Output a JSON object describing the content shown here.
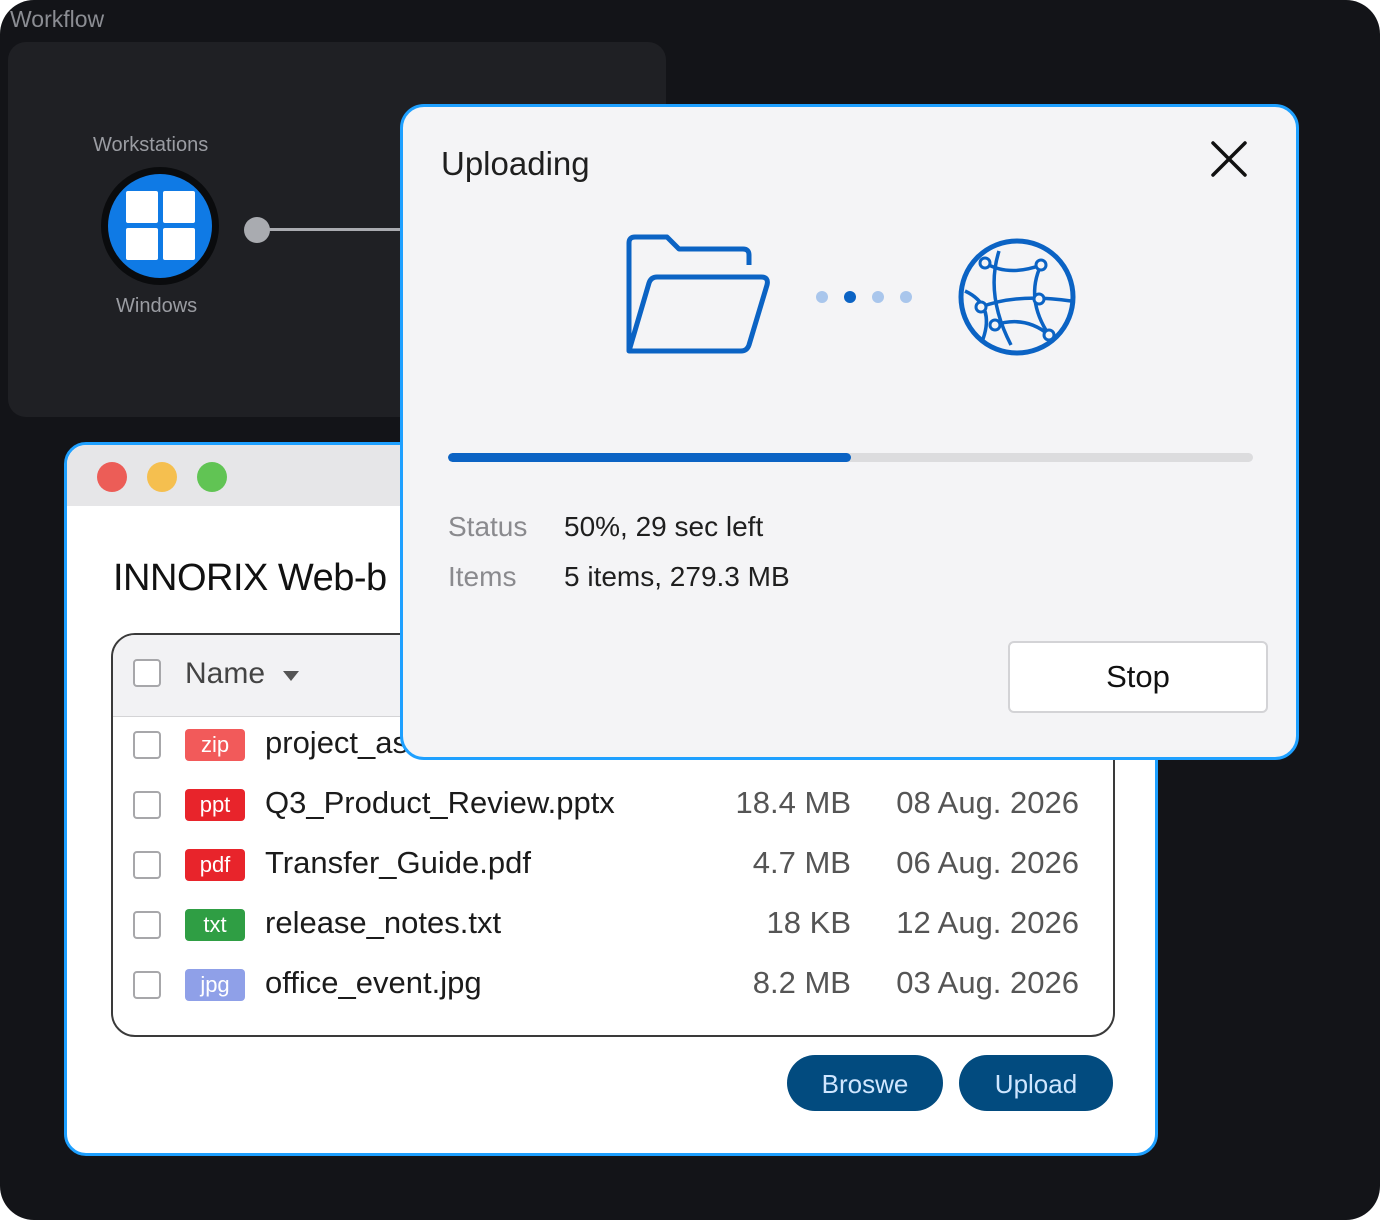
{
  "workflow": {
    "label": "Workflow",
    "node_title": "Workstations",
    "node_os": "Windows"
  },
  "app": {
    "title": "INNORIX Web-b",
    "table": {
      "header_name": "Name",
      "rows": [
        {
          "type": "zip",
          "name": "project_as",
          "size": "",
          "date": ""
        },
        {
          "type": "ppt",
          "name": "Q3_Product_Review.pptx",
          "size": "18.4 MB",
          "date": "08 Aug. 2026"
        },
        {
          "type": "pdf",
          "name": "Transfer_Guide.pdf",
          "size": "4.7 MB",
          "date": "06 Aug. 2026"
        },
        {
          "type": "txt",
          "name": "release_notes.txt",
          "size": "18 KB",
          "date": "12 Aug. 2026"
        },
        {
          "type": "jpg",
          "name": "office_event.jpg",
          "size": "8.2 MB",
          "date": "03 Aug. 2026"
        }
      ]
    },
    "browse_label": "Broswe",
    "upload_label": "Upload"
  },
  "dialog": {
    "title": "Uploading",
    "progress": 0.5,
    "status_label": "Status",
    "status_value": "50%, 29 sec left",
    "items_label": "Items",
    "items_value": "5 items, 279.3 MB",
    "stop_label": "Stop"
  },
  "colors": {
    "accent_border": "#1ea0ff",
    "progress": "#0b63c4",
    "windows_blue": "#0f7ae5",
    "button_navy": "#024b7f",
    "badge_zip": "#f25a5a",
    "badge_ppt": "#e8242b",
    "badge_pdf": "#e8242b",
    "badge_txt": "#2f9e44",
    "badge_jpg": "#8fa0e8"
  }
}
